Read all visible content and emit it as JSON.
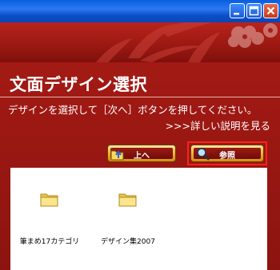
{
  "window": {
    "heading": "文面デザイン選択",
    "instruction": "デザインを選択して［次へ］ボタンを押してください。",
    "help_link": ">>>詳しい説明を見る"
  },
  "toolbar": {
    "up_label": "上へ",
    "browse_label": "参照"
  },
  "folders": [
    {
      "name": "筆まめ17カテゴリ",
      "icon": "folder-icon"
    },
    {
      "name": "デザイン集2007",
      "icon": "folder-icon"
    }
  ],
  "colors": {
    "title_bar": "#0b4fc8",
    "panel_red": "#9a1812",
    "button_gold": "#f5b934",
    "highlight_border": "#ff2020"
  }
}
